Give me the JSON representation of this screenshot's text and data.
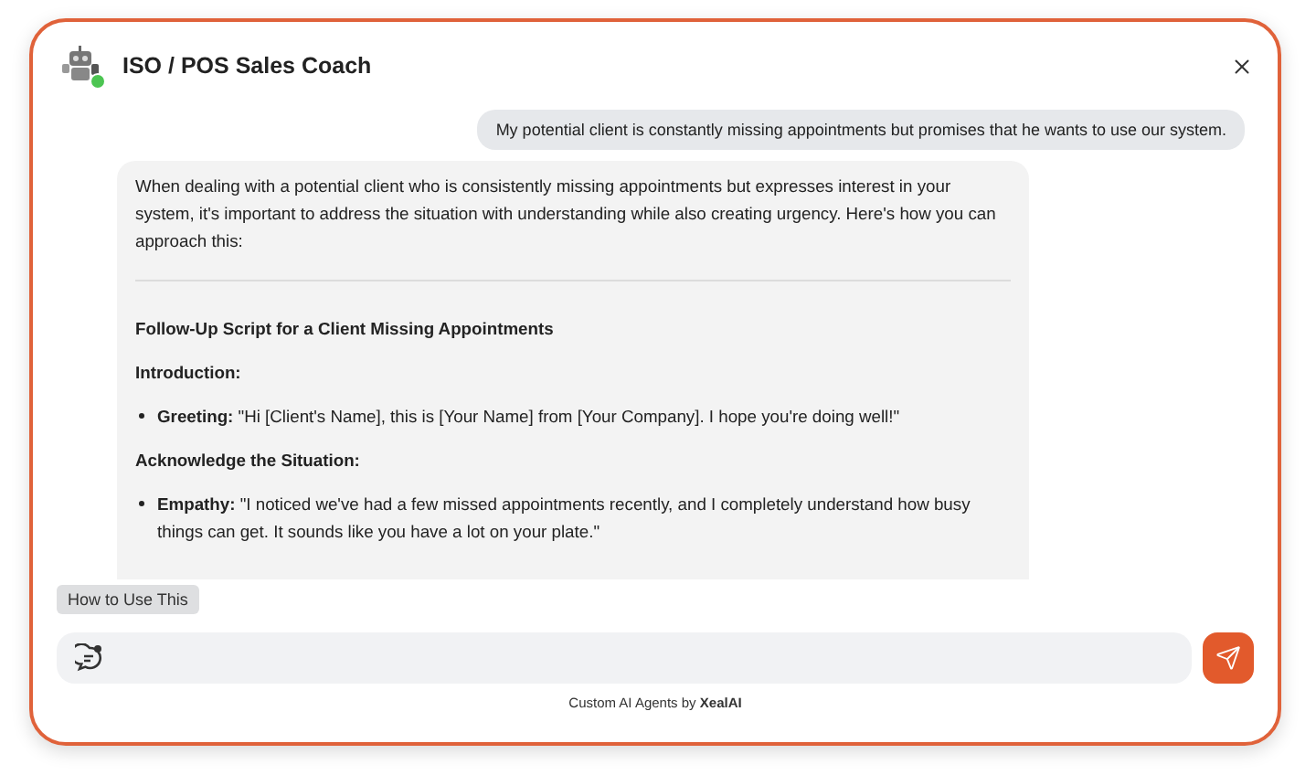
{
  "header": {
    "title": "ISO / POS Sales Coach",
    "online": true
  },
  "messages": [
    {
      "kind": "user",
      "text": "My potential client is constantly missing appointments but promises that he wants to use our system."
    },
    {
      "kind": "bot",
      "blocks": [
        {
          "kind": "paragraph",
          "text": "When dealing with a potential client who is consistently missing appointments but expresses interest in your system, it's important to address the situation with understanding while also creating urgency. Here's how you can approach this:"
        },
        {
          "kind": "divider"
        },
        {
          "kind": "heading",
          "text": "Follow-Up Script for a Client Missing Appointments"
        },
        {
          "kind": "heading",
          "text": "Introduction:"
        },
        {
          "kind": "bullet",
          "text": "**Greeting:** \"Hi [Client's Name], this is [Your Name] from [Your Company]. I hope you're doing well!\""
        },
        {
          "kind": "heading",
          "text": "Acknowledge the Situation:"
        },
        {
          "kind": "bullet",
          "text": "**Empathy:** \"I noticed we've had a few missed appointments recently, and I completely understand how busy things can get. It sounds like you have a lot on your plate.\""
        }
      ]
    }
  ],
  "suggestion": "How to Use This",
  "footer": "Custom AI Agents by **XealAI**"
}
